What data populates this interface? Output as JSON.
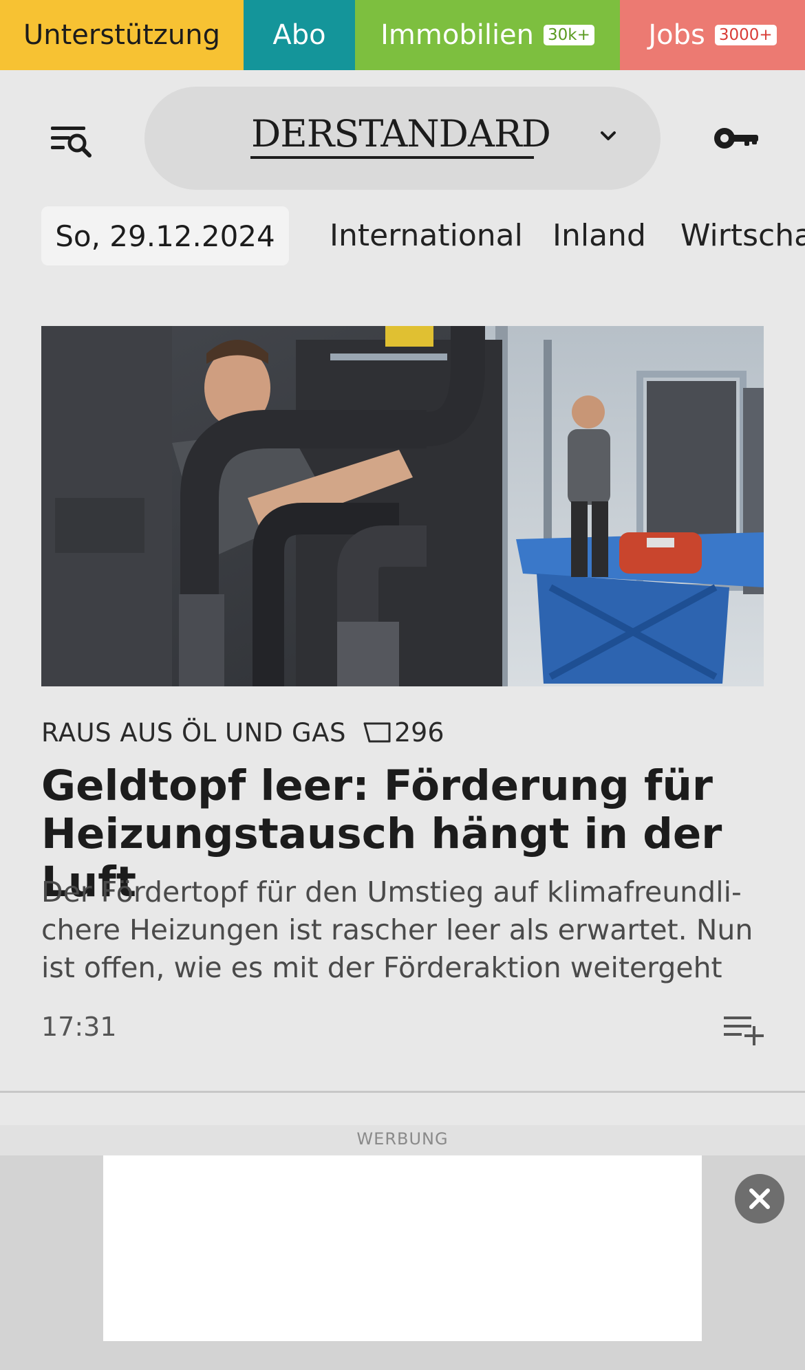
{
  "topbar": {
    "support_label": "Unterstützung",
    "abo_label": "Abo",
    "immobilien_label": "Immobilien",
    "immobilien_badge": "30k+",
    "jobs_label": "Jobs",
    "jobs_badge": "3000+"
  },
  "header": {
    "logo_text": "DERSTANDARD",
    "icons": [
      "menu-search-icon",
      "chevron-down-icon",
      "key-icon"
    ]
  },
  "nav": {
    "date": "So, 29.12.2024",
    "items": [
      "International",
      "Inland",
      "Wirtscha"
    ]
  },
  "article": {
    "image_alt": "",
    "kicker": "RAUS AUS ÖL UND GAS",
    "comment_count": "296",
    "headline": "Geldtopf leer: Förderung für Heizungstausch hängt in der Luft",
    "teaser": "Der Fördertopf für den Umstieg auf klimafreundli­chere Heizungen ist rascher leer als erwartet. Nun ist offen, wie es mit der Förderaktion weitergeht",
    "time": "17:31"
  },
  "ad": {
    "label": "WERBUNG"
  },
  "colors": {
    "support": "#f7c233",
    "abo": "#14959a",
    "immobilien": "#7dbf3f",
    "jobs": "#ec7a72",
    "page_bg": "#e8e8e8"
  }
}
